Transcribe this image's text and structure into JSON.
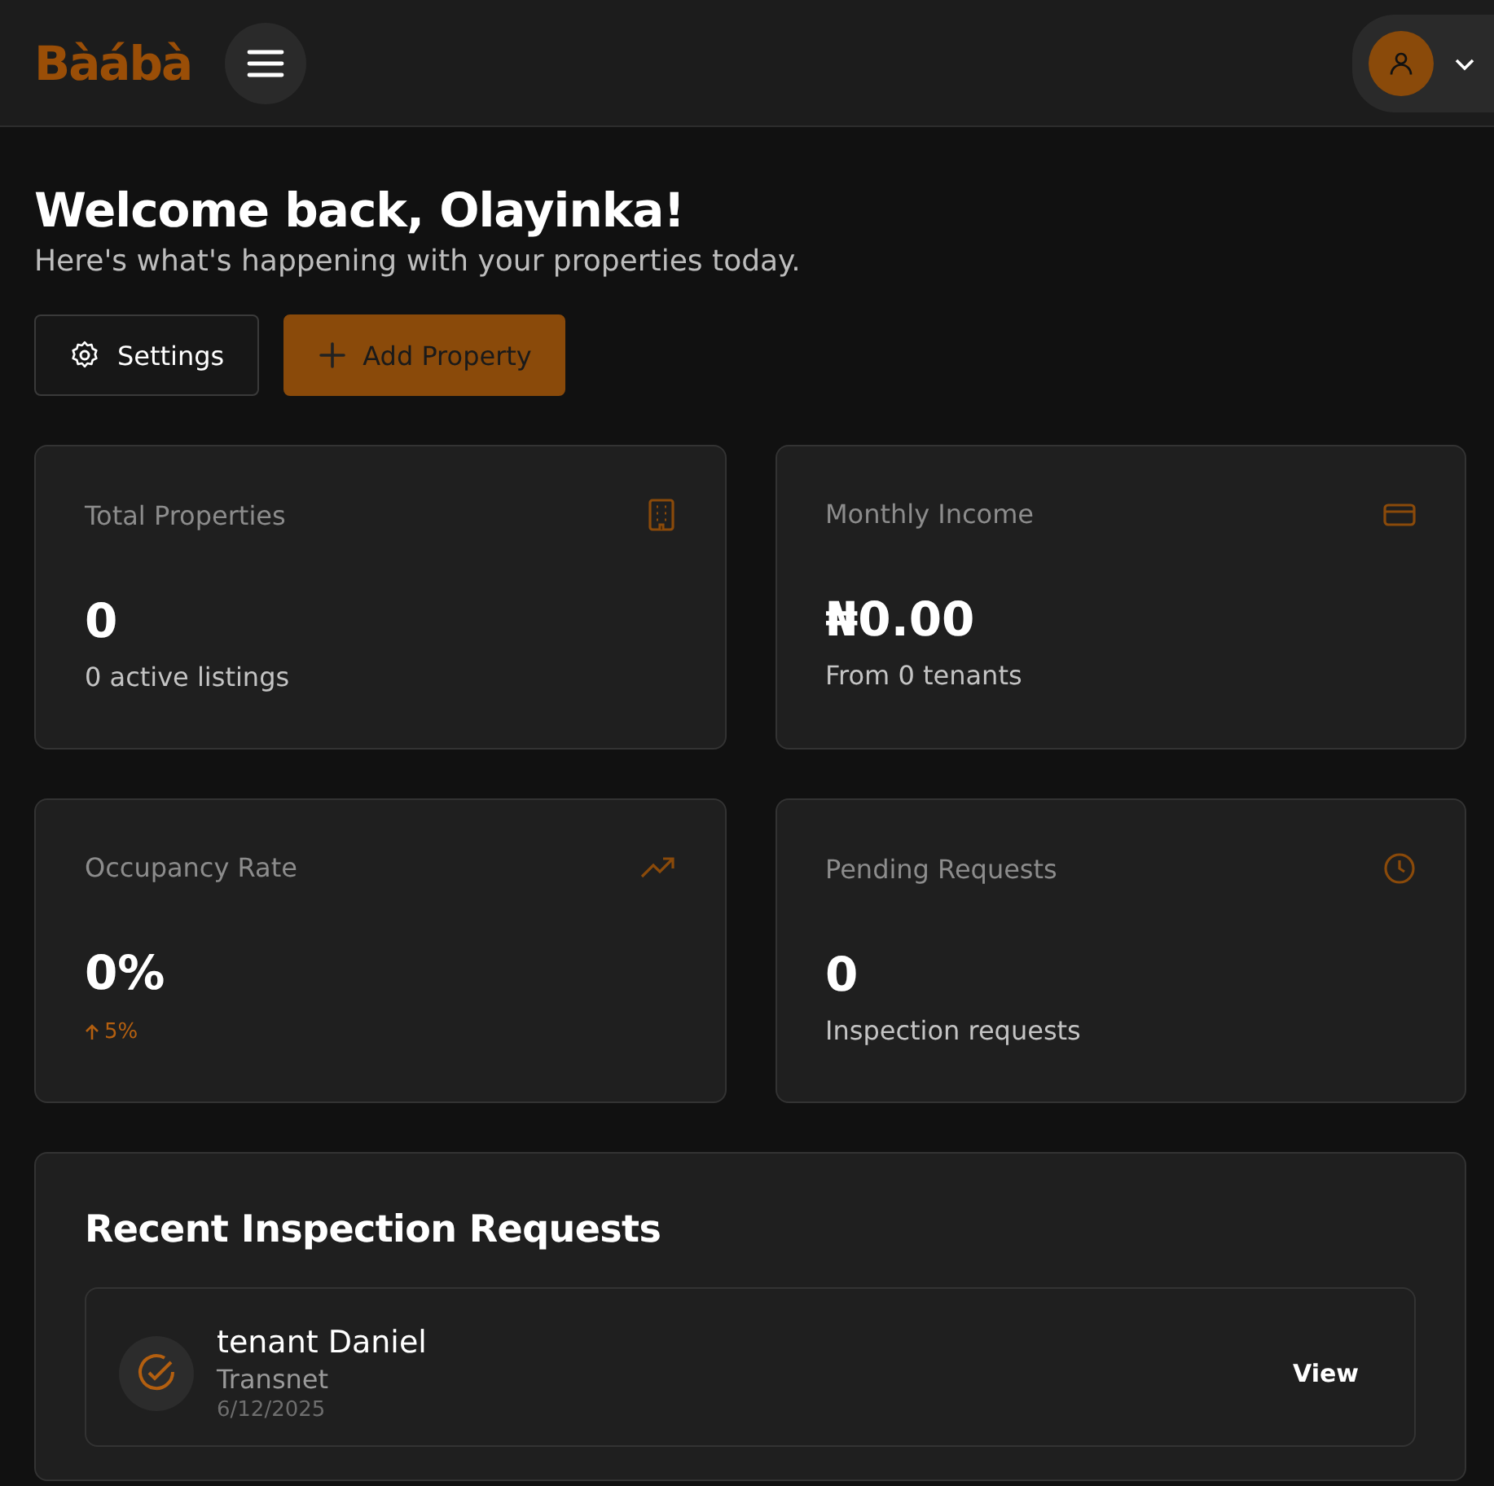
{
  "header": {
    "logo": "Bàábà"
  },
  "welcome": {
    "title": "Welcome back, Olayinka!",
    "subtitle": "Here's what's happening with your properties today."
  },
  "actions": [
    {
      "kind": "settings",
      "label": "Settings"
    },
    {
      "kind": "add",
      "label": "Add Property"
    }
  ],
  "stats": [
    {
      "kind": "plain",
      "label": "Total Properties",
      "value": "0",
      "sub": "0 active listings"
    },
    {
      "kind": "plain",
      "label": "Monthly Income",
      "value": "₦0.00",
      "sub": "From 0 tenants"
    },
    {
      "kind": "trend",
      "label": "Occupancy Rate",
      "value": "0%",
      "sub": "5%"
    },
    {
      "kind": "plain",
      "label": "Pending Requests",
      "value": "0",
      "sub": "Inspection requests"
    }
  ],
  "recent": {
    "title": "Recent Inspection Requests",
    "requests": [
      {
        "name": "tenant Daniel",
        "property": "Transnet",
        "date": "6/12/2025",
        "action": "View"
      }
    ]
  }
}
